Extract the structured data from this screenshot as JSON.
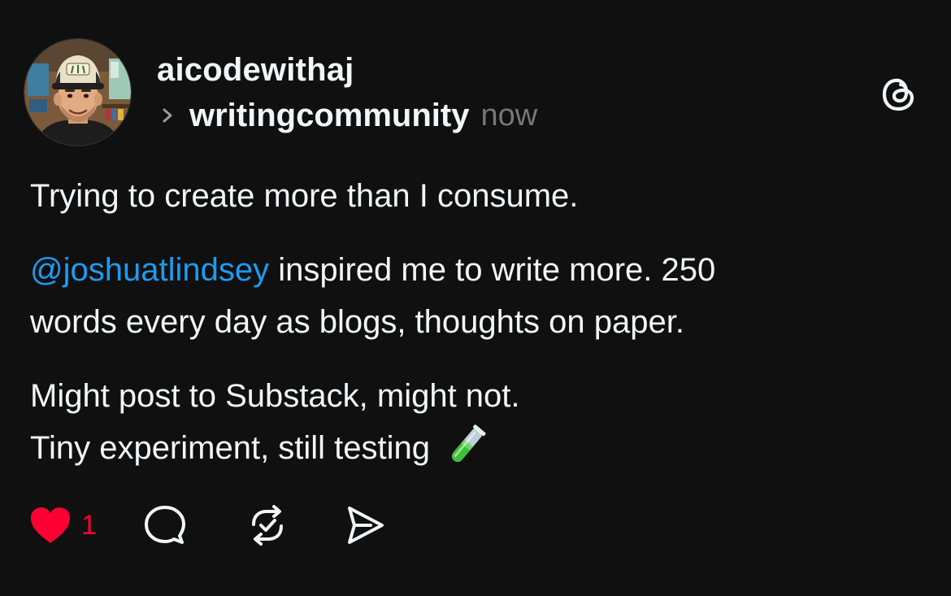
{
  "post": {
    "author": "aicodewithaj",
    "community": "writingcommunity",
    "timestamp": "now",
    "body": {
      "line1": "Trying to create more than I consume.",
      "mention": "@joshuatlindsey",
      "line2_rest": " inspired me to write more. 250",
      "line3": "words every day as blogs, thoughts on paper.",
      "line4": "Might post to Substack, might not.",
      "line5": "Tiny experiment, still testing "
    },
    "emoji": "test-tube-icon",
    "mention_color": "#1d9bf0",
    "like_color": "#fe0034"
  },
  "actions": {
    "like": {
      "icon": "heart-icon",
      "liked": true,
      "count": "1"
    },
    "reply": {
      "icon": "comment-icon"
    },
    "repost": {
      "icon": "repost-icon"
    },
    "share": {
      "icon": "send-icon"
    }
  },
  "branding": {
    "icon": "threads-logo-icon"
  }
}
